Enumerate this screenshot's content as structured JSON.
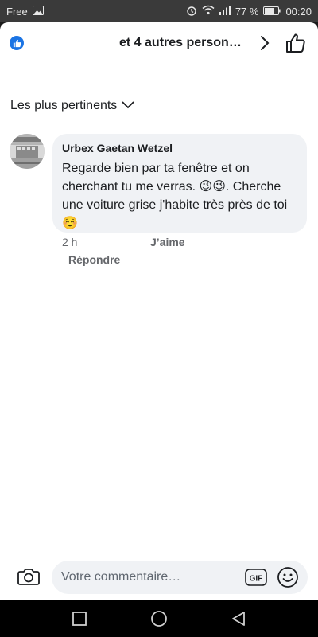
{
  "status_bar": {
    "carrier": "Free",
    "battery_percent": "77 %",
    "time": "00:20",
    "icons": [
      "image-icon",
      "alarm-icon",
      "wifi-icon",
      "signal-icon",
      "battery-icon"
    ]
  },
  "header": {
    "title": "et 4 autres person…",
    "icons": [
      "like-reaction-icon",
      "chevron-right-icon",
      "thumbs-up-icon"
    ]
  },
  "sort": {
    "label": "Les plus pertinents"
  },
  "comment": {
    "author": "Urbex Gaetan Wetzel",
    "text": "Regarde bien par ta fenêtre et on cherchant tu me verras. 😉😉. Cherche une voiture grise j'habite très près de toi ☺️",
    "time": "2 h",
    "like_label": "J’aime",
    "reply_label": "Répondre"
  },
  "composer": {
    "placeholder": "Votre commentaire…",
    "gif_label": "GIF",
    "icons": [
      "camera-icon",
      "gif-icon",
      "emoji-icon"
    ]
  },
  "nav_bar": {
    "icons": [
      "recent-apps-icon",
      "home-icon",
      "back-icon"
    ]
  },
  "colors": {
    "brand_blue": "#1b74e4",
    "bubble": "#f0f2f5",
    "text_primary": "#1c1e21",
    "text_secondary": "#65676b"
  }
}
